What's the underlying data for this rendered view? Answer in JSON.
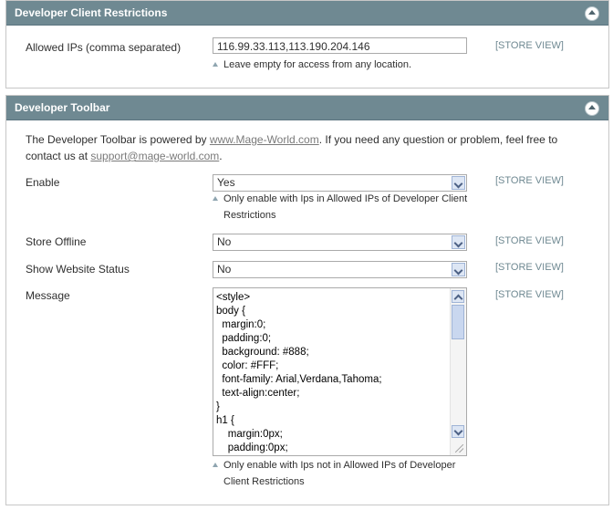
{
  "section1": {
    "title": "Developer Client Restrictions",
    "allowed_ips": {
      "label": "Allowed IPs (comma separated)",
      "value": "116.99.33.113,113.190.204.146",
      "scope": "[STORE VIEW]",
      "note": "Leave empty for access from any location."
    }
  },
  "section2": {
    "title": "Developer Toolbar",
    "intro": {
      "line1_prefix": "The Developer Toolbar is powered by ",
      "link1": "www.Mage-World.com",
      "line1_suffix": ". If you need any question or problem, feel free to",
      "line2_prefix": "contact us at ",
      "link2": "support@mage-world.com",
      "line2_suffix": "."
    },
    "enable": {
      "label": "Enable",
      "value": "Yes",
      "scope": "[STORE VIEW]",
      "note_line1": "Only enable with Ips in Allowed IPs of Developer Client",
      "note_line2": "Restrictions"
    },
    "store_offline": {
      "label": "Store Offline",
      "value": "No",
      "scope": "[STORE VIEW]"
    },
    "show_website_status": {
      "label": "Show Website Status",
      "value": "No",
      "scope": "[STORE VIEW]"
    },
    "message": {
      "label": "Message",
      "value": "<style>\nbody {\n  margin:0;\n  padding:0;\n  background: #888;\n  color: #FFF;\n  font-family: Arial,Verdana,Tahoma;\n  text-align:center;\n}\nh1 {\n    margin:0px;\n    padding:0px;",
      "scope": "[STORE VIEW]",
      "note_line1": "Only enable with Ips not in Allowed IPs of Developer",
      "note_line2": "Client Restrictions"
    }
  }
}
